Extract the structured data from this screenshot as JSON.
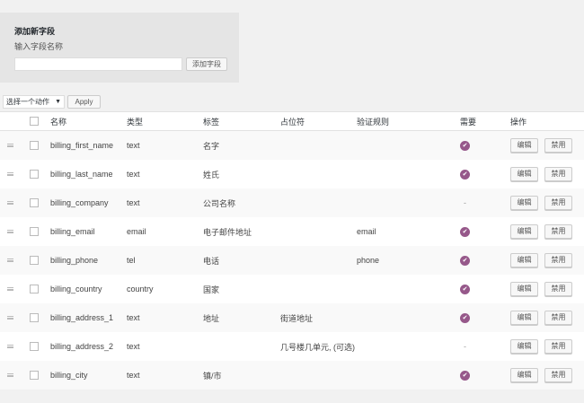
{
  "add_field": {
    "title": "添加新字段",
    "label": "输入字段名称",
    "input_value": "",
    "input_placeholder": "",
    "button_label": "添加字段"
  },
  "bulk": {
    "select_value": "选择一个动作",
    "apply_label": "Apply"
  },
  "columns": {
    "name": "名称",
    "type": "类型",
    "label": "标签",
    "placeholder": "占位符",
    "validation": "验证规则",
    "required": "需要",
    "actions": "操作"
  },
  "actions": {
    "edit": "编辑",
    "disable": "禁用"
  },
  "icons": {
    "required": "check-circle-icon",
    "drag": "drag-handle-icon"
  },
  "colors": {
    "accent": "#96588a"
  },
  "rows": [
    {
      "name": "billing_first_name",
      "type": "text",
      "label": "名字",
      "placeholder": "",
      "validation": "",
      "required": true
    },
    {
      "name": "billing_last_name",
      "type": "text",
      "label": "姓氏",
      "placeholder": "",
      "validation": "",
      "required": true
    },
    {
      "name": "billing_company",
      "type": "text",
      "label": "公司名称",
      "placeholder": "",
      "validation": "",
      "required": false
    },
    {
      "name": "billing_email",
      "type": "email",
      "label": "电子邮件地址",
      "placeholder": "",
      "validation": "email",
      "required": true
    },
    {
      "name": "billing_phone",
      "type": "tel",
      "label": "电话",
      "placeholder": "",
      "validation": "phone",
      "required": true
    },
    {
      "name": "billing_country",
      "type": "country",
      "label": "国家",
      "placeholder": "",
      "validation": "",
      "required": true
    },
    {
      "name": "billing_address_1",
      "type": "text",
      "label": "地址",
      "placeholder": "街道地址",
      "validation": "",
      "required": true
    },
    {
      "name": "billing_address_2",
      "type": "text",
      "label": "",
      "placeholder": "几号楼几单元, (可选)",
      "validation": "",
      "required": false
    },
    {
      "name": "billing_city",
      "type": "text",
      "label": "镇/市",
      "placeholder": "",
      "validation": "",
      "required": true
    }
  ]
}
